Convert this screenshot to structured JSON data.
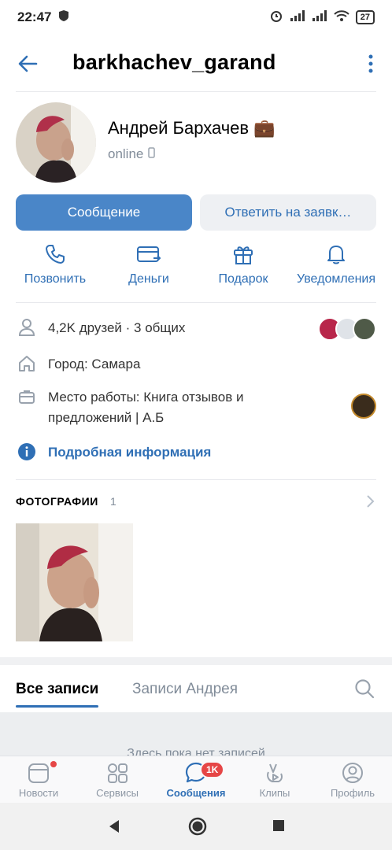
{
  "status_bar": {
    "time": "22:47",
    "battery": "27"
  },
  "header": {
    "username": "barkhachev_garand"
  },
  "profile": {
    "name": "Андрей Бархачев",
    "name_emoji": "💼",
    "status": "online"
  },
  "buttons": {
    "message": "Сообщение",
    "reply_request": "Ответить на заявк…"
  },
  "actions": [
    {
      "label": "Позвонить",
      "icon": "phone-icon"
    },
    {
      "label": "Деньги",
      "icon": "money-icon"
    },
    {
      "label": "Подарок",
      "icon": "gift-icon"
    },
    {
      "label": "Уведомления",
      "icon": "bell-icon"
    }
  ],
  "info": {
    "friends": "4,2K друзей · 3 общих",
    "city": "Город: Самара",
    "work_line1": "Место работы: Книга отзывов и",
    "work_line2": "предложений | А.Б",
    "details": "Подробная информация"
  },
  "photos": {
    "title": "ФОТОГРАФИИ",
    "count": "1"
  },
  "tabs": {
    "all_posts": "Все записи",
    "user_posts": "Записи Андрея"
  },
  "feed": {
    "empty_message": "Здесь пока нет записей"
  },
  "bottom_nav": [
    {
      "label": "Новости",
      "icon": "news-icon"
    },
    {
      "label": "Сервисы",
      "icon": "services-icon"
    },
    {
      "label": "Сообщения",
      "icon": "messages-icon",
      "badge": "1K"
    },
    {
      "label": "Клипы",
      "icon": "clips-icon"
    },
    {
      "label": "Профиль",
      "icon": "profile-icon"
    }
  ],
  "colors": {
    "accent": "#2f6fb5",
    "primary_button": "#4a86c8",
    "badge": "#e64646"
  }
}
